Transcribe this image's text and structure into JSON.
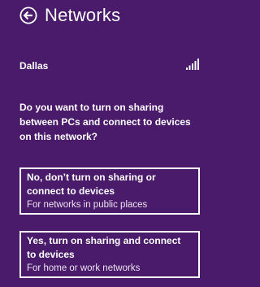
{
  "header": {
    "back_icon": "back-arrow-circle-icon",
    "title": "Networks"
  },
  "network": {
    "name": "Dallas",
    "signal_icon": "wifi-signal-bars-icon",
    "signal_bars": 5
  },
  "prompt": {
    "question": "Do you want to turn on sharing between PCs and connect to devices on this network?"
  },
  "options": [
    {
      "title": "No, don’t turn on sharing or connect to devices",
      "subtitle": "For networks in public places"
    },
    {
      "title": "Yes, turn on sharing and connect to devices",
      "subtitle": "For home or work networks"
    }
  ],
  "colors": {
    "background": "#4a1a6b",
    "foreground": "#ffffff"
  }
}
